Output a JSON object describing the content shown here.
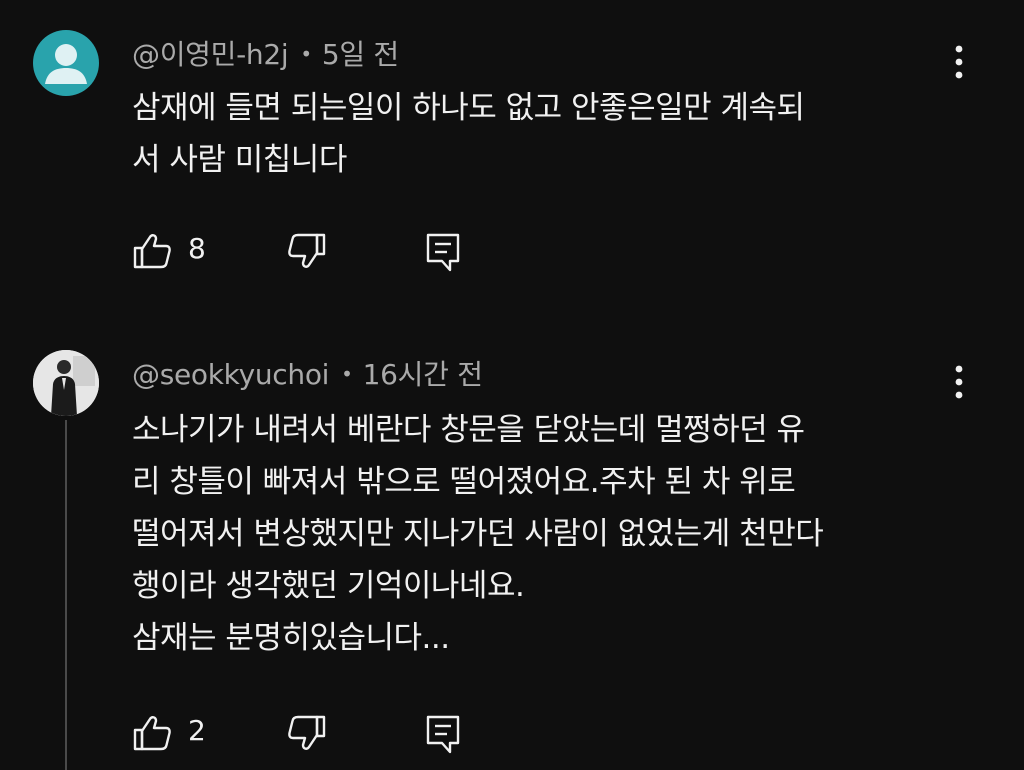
{
  "comments": [
    {
      "author": "@이영민-h2j",
      "time": "5일 전",
      "lines": [
        "삼재에 들면 되는일이 하나도 없고 안좋은일만 계속되",
        "서 사람 미칩니다"
      ],
      "likes": "8"
    },
    {
      "author": "@seokkyuchoi",
      "time": "16시간 전",
      "lines": [
        "소나기가 내려서 베란다 창문을 닫았는데 멀쩡하던 유",
        "리 창틀이 빠져서 밖으로 떨어졌어요.주차 된 차 위로",
        "떨어져서 변상했지만 지나가던 사람이 없었는게 천만다",
        "행이라 생각했던 기억이나네요.",
        "삼재는 분명히있습니다..."
      ],
      "likes": "2"
    }
  ],
  "separator": "•",
  "icons": {
    "like": "thumbs-up-icon",
    "dislike": "thumbs-down-icon",
    "reply": "reply-icon",
    "menu": "more-vertical-icon",
    "avatar_default": "person-icon"
  },
  "colors": {
    "background": "#0f0f0f",
    "text": "#f1f1f1",
    "meta": "#aaaaaa",
    "avatar_default": "#29a3ac"
  }
}
